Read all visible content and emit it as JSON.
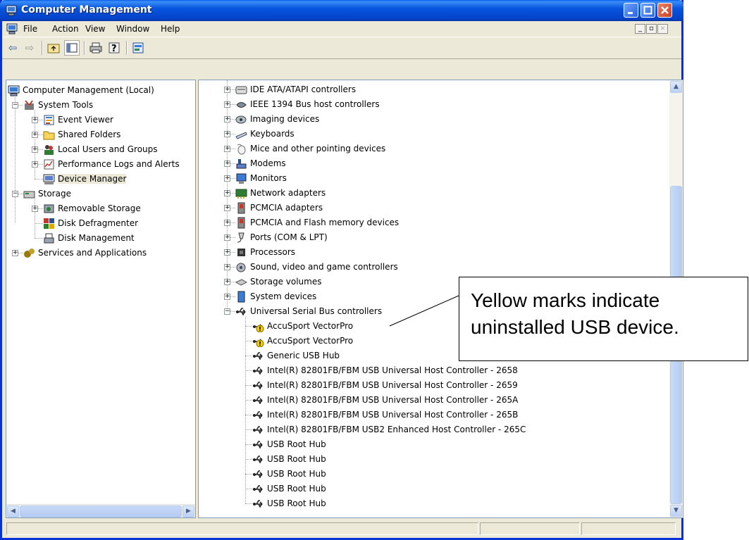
{
  "window": {
    "title": "Computer Management"
  },
  "menu": {
    "items": [
      "File",
      "Action",
      "View",
      "Window",
      "Help"
    ]
  },
  "toolbar": {
    "icons": [
      "back-arrow-icon",
      "forward-arrow-icon",
      "up-folder-icon",
      "show-hide-tree-icon",
      "print-icon",
      "help-icon",
      "properties-icon"
    ]
  },
  "left_tree": {
    "root": "Computer Management (Local)",
    "system_tools": "System Tools",
    "event_viewer": "Event Viewer",
    "shared_folders": "Shared Folders",
    "local_users": "Local Users and Groups",
    "perf_logs": "Performance Logs and Alerts",
    "device_manager": "Device Manager",
    "storage": "Storage",
    "removable_storage": "Removable Storage",
    "disk_defrag": "Disk Defragmenter",
    "disk_mgmt": "Disk Management",
    "services": "Services and Applications"
  },
  "device_categories": [
    "IDE ATA/ATAPI controllers",
    "IEEE 1394 Bus host controllers",
    "Imaging devices",
    "Keyboards",
    "Mice and other pointing devices",
    "Modems",
    "Monitors",
    "Network adapters",
    "PCMCIA adapters",
    "PCMCIA and Flash memory devices",
    "Ports (COM & LPT)",
    "Processors",
    "Sound, video and game controllers",
    "Storage volumes",
    "System devices",
    "Universal Serial Bus controllers"
  ],
  "usb_children": [
    "AccuSport VectorPro",
    "AccuSport VectorPro",
    "Generic USB Hub",
    "Intel(R) 82801FB/FBM USB Universal Host Controller - 2658",
    "Intel(R) 82801FB/FBM USB Universal Host Controller - 2659",
    "Intel(R) 82801FB/FBM USB Universal Host Controller - 265A",
    "Intel(R) 82801FB/FBM USB Universal Host Controller - 265B",
    "Intel(R) 82801FB/FBM USB2 Enhanced Host Controller - 265C",
    "USB Root Hub",
    "USB Root Hub",
    "USB Root Hub",
    "USB Root Hub",
    "USB Root Hub"
  ],
  "callout": {
    "line1": "Yellow marks indicate",
    "line2": "uninstalled USB device."
  },
  "colors": {
    "warning": "#f4d000",
    "selection": "#ece9d8",
    "titlebar": "#0855dd"
  }
}
